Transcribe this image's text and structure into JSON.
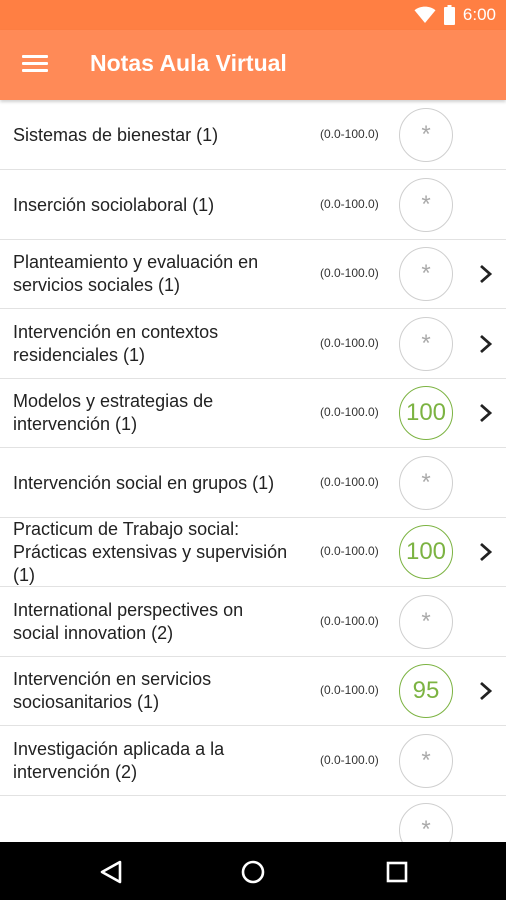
{
  "status_bar": {
    "time": "6:00",
    "icons": [
      "wifi-icon",
      "battery-icon"
    ]
  },
  "app_bar": {
    "title": "Notas Aula Virtual",
    "menu_icon": "menu-icon"
  },
  "colors": {
    "accent": "#ff8a57",
    "status": "#ff7f43",
    "pass": "#7cb342"
  },
  "courses": [
    {
      "name_lines": [
        "Sistemas de bienestar (1)"
      ],
      "range": "(0.0-100.0)",
      "grade": "*",
      "has_detail": false
    },
    {
      "name_lines": [
        "Inserción sociolaboral (1)"
      ],
      "range": "(0.0-100.0)",
      "grade": "*",
      "has_detail": false
    },
    {
      "name_lines": [
        "Planteamiento y evaluación en",
        "servicios sociales (1)"
      ],
      "range": "(0.0-100.0)",
      "grade": "*",
      "has_detail": true
    },
    {
      "name_lines": [
        "Intervención en contextos",
        "residenciales (1)"
      ],
      "range": "(0.0-100.0)",
      "grade": "*",
      "has_detail": true
    },
    {
      "name_lines": [
        "Modelos y estrategias de",
        "intervención (1)"
      ],
      "range": "(0.0-100.0)",
      "grade": "100",
      "has_detail": true
    },
    {
      "name_lines": [
        "Intervención social en grupos (1)"
      ],
      "range": "(0.0-100.0)",
      "grade": "*",
      "has_detail": false
    },
    {
      "name_lines": [
        "Practicum de Trabajo social:",
        "Prácticas extensivas y supervisión",
        "(1)"
      ],
      "range": "(0.0-100.0)",
      "grade": "100",
      "has_detail": true
    },
    {
      "name_lines": [
        "International perspectives on",
        "social innovation (2)"
      ],
      "range": "(0.0-100.0)",
      "grade": "*",
      "has_detail": false
    },
    {
      "name_lines": [
        "Intervención en servicios",
        "sociosanitarios (1)"
      ],
      "range": "(0.0-100.0)",
      "grade": "95",
      "has_detail": true
    },
    {
      "name_lines": [
        "Investigación aplicada a la",
        "intervención (2)"
      ],
      "range": "(0.0-100.0)",
      "grade": "*",
      "has_detail": false
    },
    {
      "name_lines": [
        ""
      ],
      "range": "",
      "grade": "*",
      "has_detail": false
    }
  ],
  "nav_bar": {
    "buttons": [
      "back-icon",
      "home-icon",
      "recents-icon"
    ]
  }
}
